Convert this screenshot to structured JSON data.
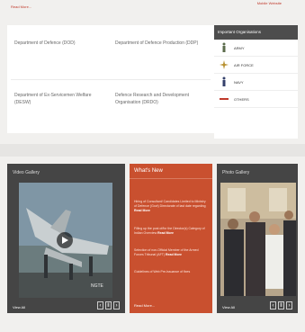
{
  "top": {
    "read_more": "Read More...",
    "mobile_link": "Mobile Website"
  },
  "departments": [
    {
      "label": "Department of Defence (DOD)"
    },
    {
      "label": "Department of Defence Production (DDP)"
    },
    {
      "label": "Department of Ex-Servicemen Welfare (DESW)"
    },
    {
      "label": "Defence Research and Development Organisation (DRDO)"
    }
  ],
  "organisations": {
    "title": "Important Organisations",
    "items": [
      {
        "label": "ARMY",
        "icon": "army-icon"
      },
      {
        "label": "AIR FORCE",
        "icon": "air-force-icon"
      },
      {
        "label": "NAVY",
        "icon": "navy-icon"
      },
      {
        "label": "OTHERS",
        "icon": "others-icon"
      }
    ]
  },
  "video_gallery": {
    "title": "Video Gallery",
    "view_all": "View All",
    "caption": "NGTE"
  },
  "whats_new": {
    "title": "What's New",
    "items": [
      {
        "text": "Hiring of Consultant/ Candidates Limited to Ministry of Defence (Govt) Directorate of last date regarding",
        "tag": "Read More"
      },
      {
        "text": "Filling up the post of/for the Director(s) Category of Indian Overview",
        "tag": "Read More"
      },
      {
        "text": "Selection of non-Official Member of the Armed Forces Tribunal (AFT)",
        "tag": "Read More"
      },
      {
        "text": "Guidelines of Web Pre-Issuance of fixes",
        "tag": ""
      }
    ],
    "read_more": "Read More..."
  },
  "photo_gallery": {
    "title": "Photo Gallery",
    "view_all": "View All"
  },
  "colors": {
    "accent": "#c9502f",
    "panel_dark": "#454545",
    "header_dark": "#4d4d4d"
  }
}
